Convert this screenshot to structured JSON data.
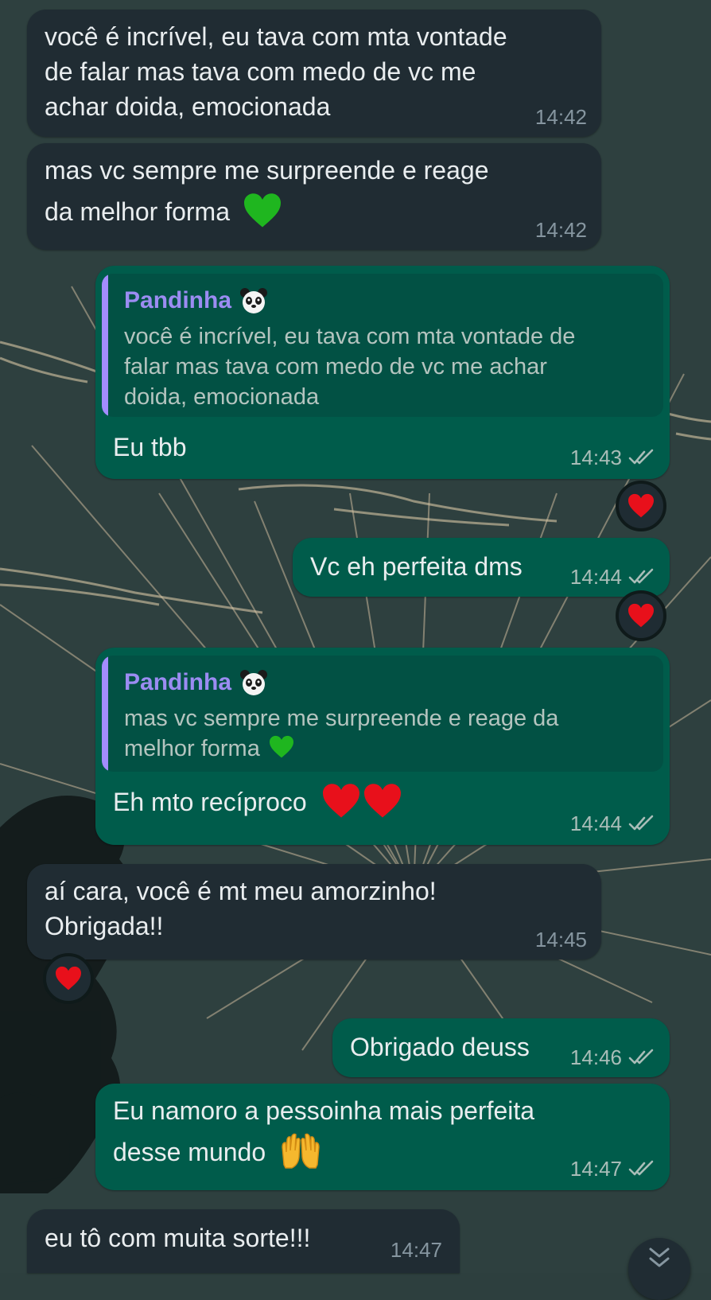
{
  "theme": {
    "incoming_bubble": "#202c33",
    "outgoing_bubble": "#005c4b",
    "quote_bar": "#a38cff",
    "read_tick": "#a9bdb8",
    "heart": "#e8101b",
    "green_heart": "#22c322"
  },
  "quote_author": "Pandinha",
  "messages": [
    {
      "id": "m1",
      "dir": "in",
      "lines": [
        "você é incrível,  eu tava com mta vontade",
        "de falar mas tava com medo de vc me",
        "achar doida, emocionada"
      ],
      "time": "14:42"
    },
    {
      "id": "m2",
      "dir": "in",
      "lines": [
        "mas vc sempre me surpreende e reage",
        "da melhor forma"
      ],
      "emoji": "green-heart",
      "time": "14:42"
    },
    {
      "id": "m3",
      "dir": "out",
      "quote_lines": [
        "você é incrível,  eu tava com mta vontade de",
        "falar mas tava com medo de vc me achar",
        "doida, emocionada"
      ],
      "text": "Eu tbb",
      "time": "14:43",
      "reaction": "red-heart"
    },
    {
      "id": "m4",
      "dir": "out",
      "text": "Vc eh perfeita dms",
      "time": "14:44",
      "reaction": "red-heart"
    },
    {
      "id": "m5",
      "dir": "out",
      "quote_lines": [
        "mas vc sempre me surpreende e reage da",
        "melhor forma"
      ],
      "quote_emoji": "green-heart",
      "text": "Eh mto recíproco",
      "emoji": "two-red-hearts",
      "time": "14:44"
    },
    {
      "id": "m6",
      "dir": "in",
      "lines": [
        "aí cara, você é mt meu amorzinho!",
        "Obrigada!!"
      ],
      "time": "14:45",
      "reaction": "red-heart"
    },
    {
      "id": "m7",
      "dir": "out",
      "text": "Obrigado deuss",
      "time": "14:46"
    },
    {
      "id": "m8",
      "dir": "out",
      "lines": [
        "Eu namoro a pessoinha mais perfeita",
        "desse mundo"
      ],
      "emoji": "raised-hands",
      "time": "14:47"
    },
    {
      "id": "m9",
      "dir": "in",
      "text": "eu tô com muita sorte!!!",
      "time": "14:47"
    }
  ],
  "scroll_down_icon": "double-chevron-down-icon"
}
